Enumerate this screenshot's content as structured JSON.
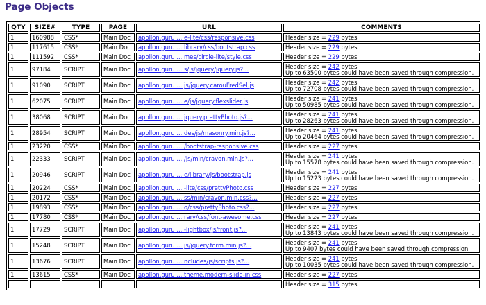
{
  "page": {
    "title": "Page Objects"
  },
  "table": {
    "headers": {
      "qty": "QTY",
      "size": "SIZE#",
      "type": "TYPE",
      "page": "PAGE",
      "url": "URL",
      "comments": "COMMENTS"
    },
    "rows": [
      {
        "qty": "1",
        "size": "160988",
        "type": "CSS*",
        "page": "Main Doc",
        "url": "apollon.guru ... e-lite/css/responsive.css",
        "header_prefix": "Header size = ",
        "header_size": "229",
        "header_suffix": " bytes",
        "note": ""
      },
      {
        "qty": "1",
        "size": "117615",
        "type": "CSS*",
        "page": "Main Doc",
        "url": "apollon.guru ... library/css/bootstrap.css",
        "header_prefix": "Header size = ",
        "header_size": "229",
        "header_suffix": " bytes",
        "note": ""
      },
      {
        "qty": "1",
        "size": "111592",
        "type": "CSS*",
        "page": "Main Doc",
        "url": "apollon.guru ... mes/circle-lite/style.css",
        "header_prefix": "Header size = ",
        "header_size": "229",
        "header_suffix": " bytes",
        "note": ""
      },
      {
        "qty": "1",
        "size": "97184",
        "type": "SCRIPT",
        "page": "Main Doc",
        "url": "apollon.guru ... s/js/jquery/jquery.js?...",
        "header_prefix": "Header size = ",
        "header_size": "242",
        "header_suffix": " bytes",
        "note": "Up to 63500 bytes could have been saved through compression."
      },
      {
        "qty": "1",
        "size": "91090",
        "type": "SCRIPT",
        "page": "Main Doc",
        "url": "apollon.guru ... js/jquery.carouFredSel.js",
        "header_prefix": "Header size = ",
        "header_size": "242",
        "header_suffix": " bytes",
        "note": "Up to 72708 bytes could have been saved through compression."
      },
      {
        "qty": "1",
        "size": "62075",
        "type": "SCRIPT",
        "page": "Main Doc",
        "url": "apollon.guru ... e/js/jquery.flexslider.js",
        "header_prefix": "Header size = ",
        "header_size": "241",
        "header_suffix": " bytes",
        "note": "Up to 50985 bytes could have been saved through compression."
      },
      {
        "qty": "1",
        "size": "38068",
        "type": "SCRIPT",
        "page": "Main Doc",
        "url": "apollon.guru ... jquery.prettyPhoto.js?...",
        "header_prefix": "Header size = ",
        "header_size": "241",
        "header_suffix": " bytes",
        "note": "Up to 28263 bytes could have been saved through compression."
      },
      {
        "qty": "1",
        "size": "28954",
        "type": "SCRIPT",
        "page": "Main Doc",
        "url": "apollon.guru ... des/js/masonry.min.js?...",
        "header_prefix": "Header size = ",
        "header_size": "241",
        "header_suffix": " bytes",
        "note": "Up to 20464 bytes could have been saved through compression."
      },
      {
        "qty": "1",
        "size": "23220",
        "type": "CSS*",
        "page": "Main Doc",
        "url": "apollon.guru ... /bootstrap-responsive.css",
        "header_prefix": "Header size = ",
        "header_size": "227",
        "header_suffix": " bytes",
        "note": ""
      },
      {
        "qty": "1",
        "size": "22333",
        "type": "SCRIPT",
        "page": "Main Doc",
        "url": "apollon.guru ... /js/min/cravon.min.js?...",
        "header_prefix": "Header size = ",
        "header_size": "241",
        "header_suffix": " bytes",
        "note": "Up to 15578 bytes could have been saved through compression."
      },
      {
        "qty": "1",
        "size": "20946",
        "type": "SCRIPT",
        "page": "Main Doc",
        "url": "apollon.guru ... e/library/js/bootstrap.js",
        "header_prefix": "Header size = ",
        "header_size": "241",
        "header_suffix": " bytes",
        "note": "Up to 15223 bytes could have been saved through compression."
      },
      {
        "qty": "1",
        "size": "20224",
        "type": "CSS*",
        "page": "Main Doc",
        "url": "apollon.guru ... -lite/css/prettyPhoto.css",
        "header_prefix": "Header size = ",
        "header_size": "227",
        "header_suffix": " bytes",
        "note": ""
      },
      {
        "qty": "1",
        "size": "20172",
        "type": "CSS*",
        "page": "Main Doc",
        "url": "apollon.guru ... ss/min/cravon.min.css?...",
        "header_prefix": "Header size = ",
        "header_size": "227",
        "header_suffix": " bytes",
        "note": ""
      },
      {
        "qty": "1",
        "size": "19893",
        "type": "CSS*",
        "page": "Main Doc",
        "url": "apollon.guru ... o/css/prettyPhoto.css?...",
        "header_prefix": "Header size = ",
        "header_size": "227",
        "header_suffix": " bytes",
        "note": ""
      },
      {
        "qty": "1",
        "size": "17780",
        "type": "CSS*",
        "page": "Main Doc",
        "url": "apollon.guru ... rary/css/font-awesome.css",
        "header_prefix": "Header size = ",
        "header_size": "227",
        "header_suffix": " bytes",
        "note": ""
      },
      {
        "qty": "1",
        "size": "17729",
        "type": "SCRIPT",
        "page": "Main Doc",
        "url": "apollon.guru ... -lightbox/js/front.js?...",
        "header_prefix": "Header size = ",
        "header_size": "241",
        "header_suffix": " bytes",
        "note": "Up to 13843 bytes could have been saved through compression."
      },
      {
        "qty": "1",
        "size": "15248",
        "type": "SCRIPT",
        "page": "Main Doc",
        "url": "apollon.guru ... js/jquery.form.min.js?...",
        "header_prefix": "Header size = ",
        "header_size": "241",
        "header_suffix": " bytes",
        "note": "Up to 9407 bytes could have been saved through compression."
      },
      {
        "qty": "1",
        "size": "13676",
        "type": "SCRIPT",
        "page": "Main Doc",
        "url": "apollon.guru ... ncludes/js/scripts.js?...",
        "header_prefix": "Header size = ",
        "header_size": "241",
        "header_suffix": " bytes",
        "note": "Up to 10035 bytes could have been saved through compression."
      },
      {
        "qty": "1",
        "size": "13615",
        "type": "CSS*",
        "page": "Main Doc",
        "url": "apollon.guru ... theme.modern-slide-in.css",
        "header_prefix": "Header size = ",
        "header_size": "227",
        "header_suffix": " bytes",
        "note": ""
      },
      {
        "qty": "",
        "size": "",
        "type": "",
        "page": "",
        "url": "",
        "header_prefix": "Header size = ",
        "header_size": "315",
        "header_suffix": " bytes",
        "note": ""
      }
    ]
  },
  "colors": {
    "title": "#3b2a86",
    "link": "#1a1aee",
    "border": "#000000"
  }
}
